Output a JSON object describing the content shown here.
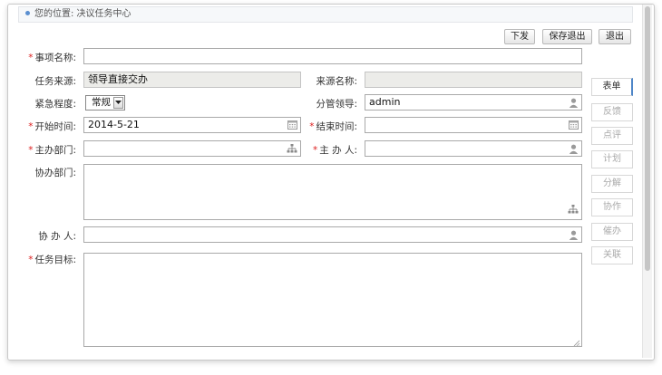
{
  "breadcrumb": "您的位置: 决议任务中心",
  "toolbar": {
    "issue_label": "下发",
    "save_exit_label": "保存退出",
    "exit_label": "退出"
  },
  "form": {
    "item_name": {
      "label": "事项名称:",
      "value": ""
    },
    "task_source": {
      "label": "任务来源:",
      "value": "领导直接交办"
    },
    "source_name": {
      "label": "来源名称:",
      "value": ""
    },
    "urgency": {
      "label": "紧急程度:",
      "value": "常规"
    },
    "leader": {
      "label": "分管领导:",
      "value": "admin"
    },
    "start_time": {
      "label": "开始时间:",
      "value": "2014-5-21"
    },
    "end_time": {
      "label": "结束时间:",
      "value": ""
    },
    "lead_dept": {
      "label": "主办部门:",
      "value": ""
    },
    "lead_person": {
      "label": "主 办 人:",
      "value": ""
    },
    "co_dept": {
      "label": "协办部门:",
      "value": ""
    },
    "co_person": {
      "label": "协 办 人:",
      "value": ""
    },
    "task_goal": {
      "label": "任务目标:",
      "value": ""
    }
  },
  "required_mark": "*",
  "tabs": [
    "表单",
    "反馈",
    "点评",
    "计划",
    "分解",
    "协作",
    "催办",
    "关联"
  ],
  "active_tab": "表单",
  "colors": {
    "accent": "#4e86c8",
    "required": "#dd2222"
  }
}
